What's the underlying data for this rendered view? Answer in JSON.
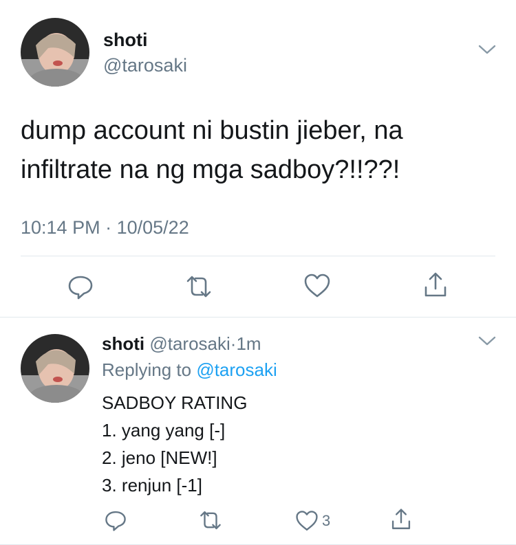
{
  "main_tweet": {
    "author_name": "shoti",
    "author_handle": "@tarosaki",
    "text_line1": "dump account ni bustin jieber, na",
    "text_line2": "infiltrate na ng mga sadboy?!!??!",
    "time": "10:14 PM",
    "separator": "·",
    "date": "10/05/22"
  },
  "reply_tweet": {
    "author_name": "shoti",
    "author_handle": "@tarosaki",
    "separator": "·",
    "age": "1m",
    "replying_prefix": "Replying to",
    "replying_handle": "@tarosaki",
    "lines": [
      "SADBOY RATING",
      "1. yang yang [-]",
      "2. jeno [NEW!]",
      "3. renjun [-1]"
    ],
    "like_count": "3"
  },
  "colors": {
    "text": "#14171a",
    "muted": "#657786",
    "link": "#1da1f2",
    "divider": "#e1e8ed"
  }
}
